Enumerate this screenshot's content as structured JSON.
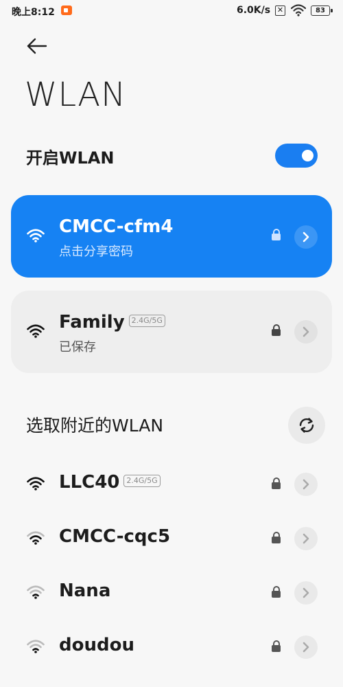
{
  "status_bar": {
    "time": "晚上8:12",
    "net_speed": "6.0K/s",
    "close_glyph": "✕",
    "battery": "83"
  },
  "page": {
    "title": "WLAN"
  },
  "wlan_toggle": {
    "label": "开启WLAN",
    "on": true
  },
  "connected": {
    "name": "CMCC-cfm4",
    "subtitle": "点击分享密码",
    "locked": true
  },
  "saved": {
    "name": "Family",
    "band": "2.4G/5G",
    "subtitle": "已保存",
    "locked": true
  },
  "nearby": {
    "label": "选取附近的WLAN",
    "networks": [
      {
        "name": "LLC40",
        "band": "2.4G/5G",
        "locked": true
      },
      {
        "name": "CMCC-cqc5",
        "band": "",
        "locked": true
      },
      {
        "name": "Nana",
        "band": "",
        "locked": true
      },
      {
        "name": "doudou",
        "band": "",
        "locked": true
      }
    ]
  },
  "icons": {
    "back": "arrow-left-icon",
    "wifi": "wifi-icon",
    "lock": "lock-icon",
    "chevron": "chevron-right-icon",
    "refresh": "refresh-icon"
  },
  "colors": {
    "accent": "#1682f3",
    "toggle": "#1a7ef1",
    "card_bg": "#eeeeee"
  }
}
